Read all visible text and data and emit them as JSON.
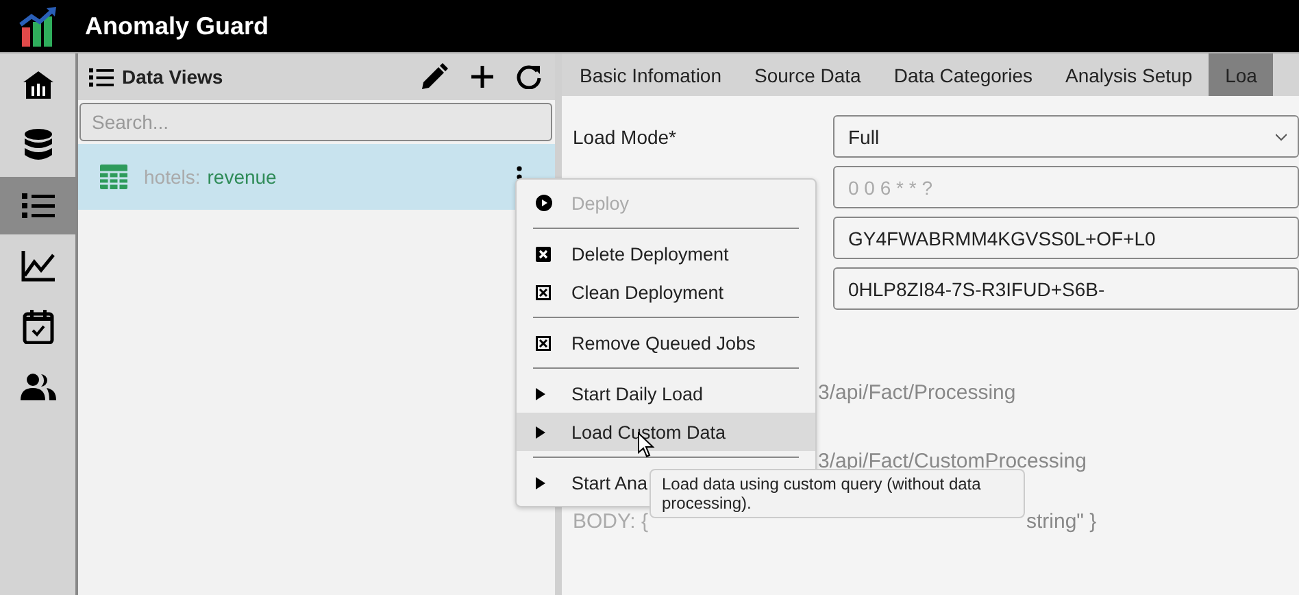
{
  "app": {
    "title": "Anomaly Guard"
  },
  "rail": [
    {
      "kind": "home",
      "selected": false
    },
    {
      "kind": "database",
      "selected": false
    },
    {
      "kind": "list",
      "selected": true
    },
    {
      "kind": "chart",
      "selected": false
    },
    {
      "kind": "calendar",
      "selected": false
    },
    {
      "kind": "people",
      "selected": false
    }
  ],
  "panel": {
    "title": "Data Views",
    "search": {
      "placeholder": "Search..."
    },
    "items": [
      {
        "source": "hotels:",
        "name": "revenue",
        "selected": true
      }
    ]
  },
  "tabs": [
    {
      "label": "Basic Infomation",
      "selected": false
    },
    {
      "label": "Source Data",
      "selected": false
    },
    {
      "label": "Data Categories",
      "selected": false
    },
    {
      "label": "Analysis Setup",
      "selected": false
    },
    {
      "label": "Loa",
      "selected": true
    }
  ],
  "form": {
    "load_mode": {
      "label": "Load Mode*",
      "value": "Full"
    },
    "fields": [
      {
        "placeholder": "0 0 6 * * ?"
      },
      {
        "value": "GY4FWABRMM4KGVSS0L+OF+L0"
      },
      {
        "value": "0HLP8ZI84-7S-R3IFUD+S6B-"
      }
    ],
    "endpoint_1": "3/api/Fact/Processing",
    "endpoint_2": "3/api/Fact/CustomProcessing",
    "body_start": "BODY: {",
    "body_end": "string\" }"
  },
  "menu": [
    {
      "kind": "circle",
      "label": "Deploy",
      "disabled": true,
      "highlighted": false
    },
    {
      "kind": "separator"
    },
    {
      "kind": "filled",
      "label": "Delete Deployment",
      "disabled": false,
      "highlighted": false
    },
    {
      "kind": "boxed",
      "label": "Clean Deployment",
      "disabled": false,
      "highlighted": false
    },
    {
      "kind": "separator"
    },
    {
      "kind": "boxed",
      "label": "Remove Queued Jobs",
      "disabled": false,
      "highlighted": false
    },
    {
      "kind": "separator"
    },
    {
      "kind": "play",
      "label": "Start Daily Load",
      "disabled": false,
      "highlighted": false
    },
    {
      "kind": "play",
      "label": "Load Custom Data",
      "disabled": false,
      "highlighted": true
    },
    {
      "kind": "separator"
    },
    {
      "kind": "play",
      "label": "Start Ana",
      "disabled": false,
      "highlighted": false
    }
  ],
  "tooltip": "Load data using custom query (without data processing)."
}
